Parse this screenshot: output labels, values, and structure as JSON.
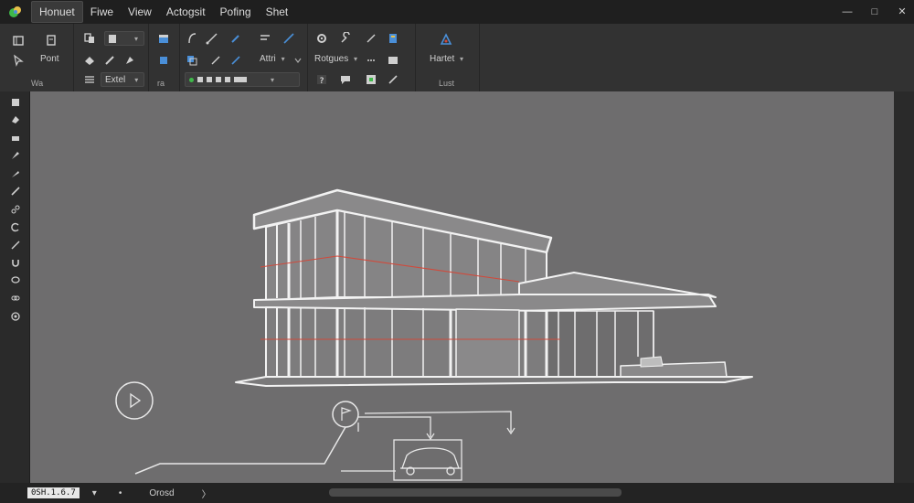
{
  "menubar": {
    "items": [
      "Honuet",
      "Fiwe",
      "View",
      "Actogsit",
      "Pofing",
      "Shet"
    ],
    "active_index": 0
  },
  "ribbon": {
    "labels": {
      "pont": "Pont",
      "wa": "Wa",
      "extel": "Extel",
      "ra": "ra",
      "attri": "Attri",
      "rotgues": "Rotgues",
      "hartet": "Hartet",
      "lust": "Lust"
    },
    "colors": {
      "accent_blue": "#4a8fd8",
      "accent_green": "#3fb84a",
      "accent_yellow": "#e8c04a"
    }
  },
  "status": {
    "coordinate": "0SH.1.6.7",
    "mode_label": "Orosd"
  },
  "drawing": {
    "edge_color": "#f2f2f2",
    "section_line_color": "#d04a3c",
    "icons": [
      "play-marker-icon",
      "flag-marker-icon",
      "car-icon"
    ]
  }
}
